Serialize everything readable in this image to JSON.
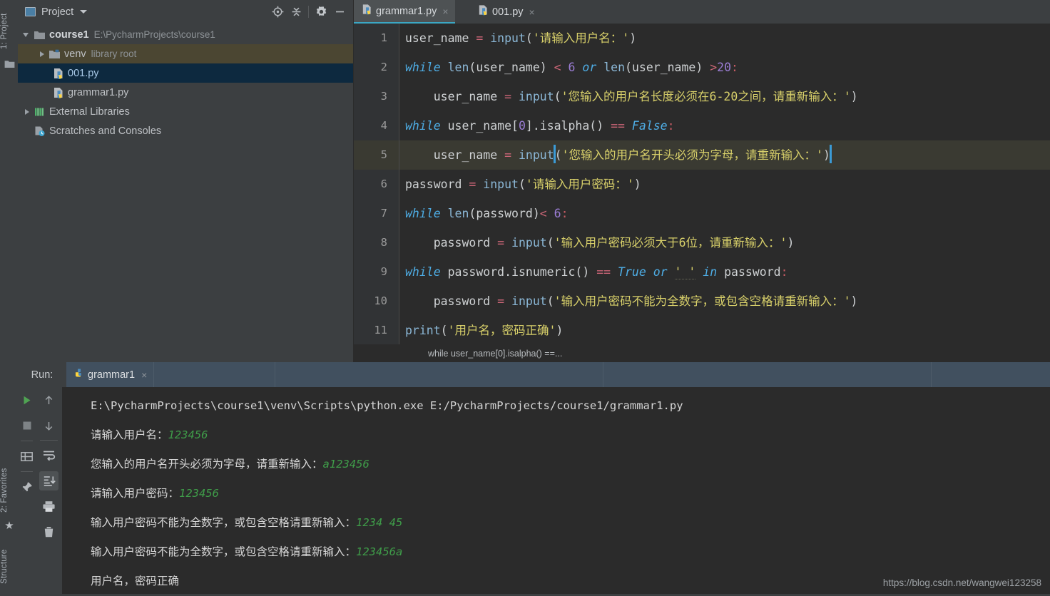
{
  "rail": {
    "project_label": "1: Project",
    "favorites_label": "2: Favorites",
    "structure_label": "Structure"
  },
  "project_panel": {
    "title": "Project",
    "icons": [
      "locate-icon",
      "collapse-all-icon",
      "settings-gear-icon",
      "minimize-icon"
    ],
    "tree": [
      {
        "label": "course1",
        "sub": "E:\\PycharmProjects\\course1",
        "kind": "folder-open",
        "depth": 0,
        "state": "expanded"
      },
      {
        "label": "venv",
        "sub": "library root",
        "kind": "folder-venv",
        "depth": 1,
        "state": "collapsed"
      },
      {
        "label": "001.py",
        "sub": "",
        "kind": "python-file",
        "depth": 2,
        "state": "selected"
      },
      {
        "label": "grammar1.py",
        "sub": "",
        "kind": "python-file",
        "depth": 2,
        "state": "none"
      },
      {
        "label": "External Libraries",
        "sub": "",
        "kind": "libraries",
        "depth": 0,
        "state": "collapsed"
      },
      {
        "label": "Scratches and Consoles",
        "sub": "",
        "kind": "scratches",
        "depth": 0,
        "state": "none"
      }
    ]
  },
  "editor": {
    "tabs": [
      {
        "label": "grammar1.py",
        "active": true,
        "close": "×"
      },
      {
        "label": "001.py",
        "active": false,
        "close": "×"
      }
    ],
    "line_numbers": [
      "1",
      "2",
      "3",
      "4",
      "5",
      "6",
      "7",
      "8",
      "9",
      "10",
      "11"
    ],
    "current_line": 5,
    "breadcrumb": "while user_name[0].isalpha() ==...",
    "code_lines": [
      "user_name = input('请输入用户名：')",
      "while len(user_name) < 6 or len(user_name) >20:",
      "    user_name = input('您输入的用户名长度必须在6-20之间，请重新输入：')",
      "while user_name[0].isalpha() == False:",
      "    user_name = input('您输入的用户名开头必须为字母，请重新输入：')",
      "password = input('请输入用户密码：')",
      "while len(password)< 6:",
      "    password = input('输入用户密码必须大于6位，请重新输入：')",
      "while password.isnumeric() == True or ' ' in password:",
      "    password = input('输入用户密码不能为全数字，或包含空格请重新输入：')",
      "print('用户名，密码正确')"
    ],
    "tokens": {
      "l1": {
        "var": "user_name",
        "eq": "=",
        "fn": "input",
        "str": "'请输入用户名：'"
      },
      "l2": {
        "kw": "while",
        "fn": "len",
        "arg": "user_name",
        "lt": "<",
        "num6": "6",
        "or": "or",
        "gt": ">",
        "num20": "20",
        "colon": ":"
      },
      "l3": {
        "var": "user_name",
        "eq": "=",
        "fn": "input",
        "str": "'您输入的用户名长度必须在6-20之间，请重新输入：'"
      },
      "l4": {
        "kw": "while",
        "expr": "user_name[",
        "idx": "0",
        "expr2": "].isalpha()",
        "eqeq": "==",
        "const": "False",
        "colon": ":"
      },
      "l5": {
        "var": "user_name",
        "eq": "=",
        "fn": "input",
        "str": "'您输入的用户名开头必须为字母，请重新输入：'"
      },
      "l6": {
        "var": "password",
        "eq": "=",
        "fn": "input",
        "str": "'请输入用户密码：'"
      },
      "l7": {
        "kw": "while",
        "fn": "len",
        "arg": "password",
        "lt": "<",
        "num": "6",
        "colon": ":"
      },
      "l8": {
        "var": "password",
        "eq": "=",
        "fn": "input",
        "str": "'输入用户密码必须大于6位，请重新输入：'"
      },
      "l9": {
        "kw": "while",
        "expr": "password.isnumeric()",
        "eqeq": "==",
        "const": "True",
        "or": "or",
        "str": "' '",
        "in": "in",
        "arg": "password",
        "colon": ":"
      },
      "l10": {
        "var": "password",
        "eq": "=",
        "fn": "input",
        "str": "'输入用户密码不能为全数字，或包含空格请重新输入：'"
      },
      "l11": {
        "fn": "print",
        "str": "'用户名，密码正确'"
      }
    }
  },
  "run_panel": {
    "label": "Run:",
    "tab_label": "grammar1",
    "tab_close": "×",
    "left_tools": [
      "run-icon",
      "stop-icon",
      "layout-icon",
      "pin-icon"
    ],
    "right_tools": [
      "arrow-up-icon",
      "arrow-down-icon",
      "soft-wrap-icon",
      "scroll-to-end-icon",
      "print-icon",
      "trash-icon"
    ],
    "console": [
      {
        "text": "E:\\PycharmProjects\\course1\\venv\\Scripts\\python.exe E:/PycharmProjects/course1/grammar1.py",
        "input": ""
      },
      {
        "text": "请输入用户名：",
        "input": "123456"
      },
      {
        "text": "您输入的用户名开头必须为字母，请重新输入：",
        "input": "a123456"
      },
      {
        "text": "请输入用户密码：",
        "input": "123456"
      },
      {
        "text": "输入用户密码不能为全数字，或包含空格请重新输入：",
        "input": "1234 45"
      },
      {
        "text": "输入用户密码不能为全数字，或包含空格请重新输入：",
        "input": "123456a"
      },
      {
        "text": "用户名，密码正确",
        "input": ""
      }
    ]
  },
  "watermark": "https://blog.csdn.net/wangwei123258",
  "colors": {
    "background": "#3c3f41",
    "editor_bg": "#2b2b2b",
    "accent": "#3ba7c4",
    "selection": "#0d293f",
    "venv_row": "#4b4632",
    "string": "#d8d06a",
    "keyword": "#4eade5",
    "number": "#9b7dd4",
    "operator": "#cc6677",
    "console_input": "#3f9c49"
  }
}
